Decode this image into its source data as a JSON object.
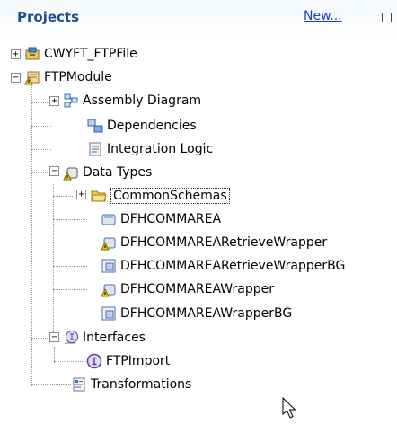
{
  "header": {
    "title": "Projects",
    "new_link": "New..."
  },
  "tree": [
    {
      "label": "CWYFT_FTPFile"
    },
    {
      "label": "FTPModule"
    },
    {
      "label": "Assembly Diagram"
    },
    {
      "label": "Dependencies"
    },
    {
      "label": "Integration Logic"
    },
    {
      "label": "Data Types"
    },
    {
      "label": "CommonSchemas"
    },
    {
      "label": "DFHCOMMAREA"
    },
    {
      "label": "DFHCOMMAREARetrieveWrapper"
    },
    {
      "label": "DFHCOMMAREARetrieveWrapperBG"
    },
    {
      "label": "DFHCOMMAREAWrapper"
    },
    {
      "label": "DFHCOMMAREAWrapperBG"
    },
    {
      "label": "Interfaces"
    },
    {
      "label": "FTPImport"
    },
    {
      "label": "Transformations"
    }
  ],
  "icons": {
    "project": "library-project-icon",
    "module": "module-warning-icon",
    "assembly": "assembly-diagram-icon",
    "dependencies": "dependencies-icon",
    "integration": "integration-logic-icon",
    "datatypes": "data-types-warning-icon",
    "folder": "folder-open-icon",
    "bo": "business-object-icon",
    "bo_warn": "business-object-warning-icon",
    "bg": "business-graph-icon",
    "interfaces": "interfaces-icon",
    "interface": "interface-icon",
    "transformations": "transformations-icon"
  },
  "colors": {
    "title": "#1f4e96",
    "link": "#1a3ad8"
  }
}
